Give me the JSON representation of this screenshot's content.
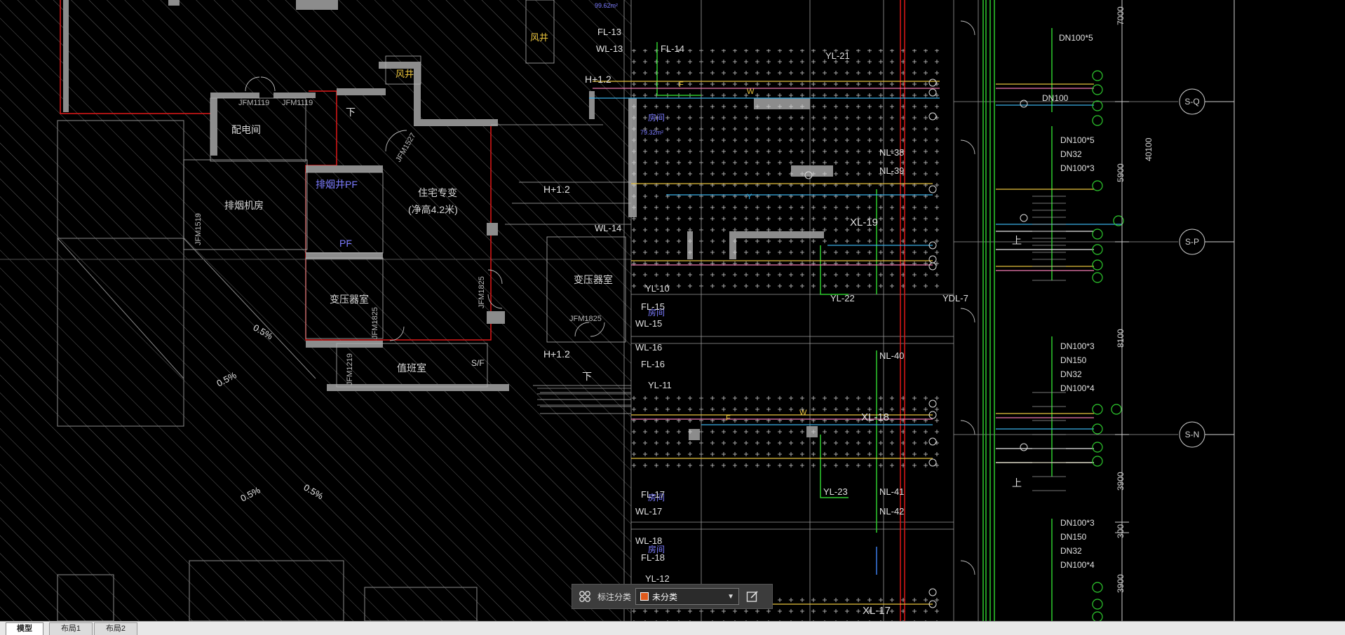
{
  "drawing": {
    "rooms": [
      "配电间",
      "排烟机房",
      "排烟井PF",
      "PF",
      "住宅专变",
      "(净高4.2米)",
      "变压器室",
      "变压器室",
      "值班室",
      "S/F",
      "风井",
      "风井",
      "房间",
      "房间",
      "房间",
      "房间"
    ],
    "door_tags": [
      "JFM1119",
      "JFM1119",
      "JFM1527",
      "JFM1519",
      "JFM1825",
      "JFM1825",
      "JFM1825",
      "JFM1219"
    ],
    "levels": [
      "H+1.2",
      "H+1.2",
      "H+1.2"
    ],
    "stairs": [
      "下",
      "下",
      "上",
      "上"
    ],
    "slopes": [
      "0.5%",
      "0.5%",
      "0.5%",
      "0.5%"
    ],
    "pipe_tags": [
      "FL-13",
      "WL-13",
      "FL-14",
      "YL-21",
      "NL-38",
      "NL-39",
      "WL-14",
      "XL-19",
      "YL-10",
      "FL-15",
      "WL-15",
      "YL-22",
      "YDL-7",
      "WL-16",
      "FL-16",
      "YL-11",
      "NL-40",
      "XL-18",
      "YL-23",
      "NL-41",
      "NL-42",
      "FL-17",
      "WL-17",
      "WL-18",
      "FL-18",
      "YL-12",
      "XL-17"
    ],
    "area_labels": [
      "99.62m²",
      "79.32m²"
    ],
    "pipe_dims": [
      "DN100*5",
      "DN100",
      "DN100*5",
      "DN32",
      "DN100*3",
      "DN100*3",
      "DN150",
      "DN32",
      "DN100*4",
      "DN100*3",
      "DN150",
      "DN32",
      "DN100*4"
    ],
    "grid_bubbles": [
      "S-Q",
      "S-P",
      "S-N"
    ],
    "dimensions": [
      "7000",
      "5900",
      "8100",
      "3900",
      "300",
      "3900",
      "40100"
    ],
    "pipe_markers": [
      "F",
      "W",
      "Y",
      "F",
      "W"
    ]
  },
  "annotation_toolbar": {
    "label": "标注分类",
    "selected": "未分类",
    "swatch_color": "#e05a1c"
  },
  "tabs": [
    "模型",
    "布局1",
    "布局2"
  ]
}
